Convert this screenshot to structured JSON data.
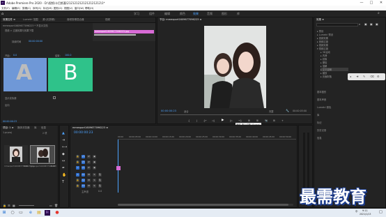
{
  "app": {
    "title": "Adobe Premiere Pro 2020 - D:\\视频\\卡巴斯基\\2121212121212121212\\1*",
    "logo": "Pr",
    "controls": [
      "—",
      "□",
      "✕"
    ]
  },
  "menu": [
    "文件(F)",
    "编辑(E)",
    "剪辑(C)",
    "序列(S)",
    "标记(M)",
    "图形(G)",
    "视图(V)",
    "窗口(W)",
    "帮助(H)"
  ],
  "workspaces": {
    "items": [
      "学习",
      "组件",
      "编辑",
      "颜色",
      "效果",
      "音频",
      "图形",
      "库"
    ],
    "active_index": 4,
    "search_icon": "search-icon"
  },
  "source_panel": {
    "tabs": [
      "效果控件 ≡",
      "Lumetri 范围",
      "源:(无剪辑)",
      "音频剪辑混合器",
      "视频"
    ],
    "clip_header": "mmexport1609677096223 * 不显示文档",
    "sub_label": "视频 > 过渡效果与效果下载",
    "timeline_clip": "mmexport1609677096223.jpg",
    "transition_time": "00:00:00:00",
    "transition_label": "持续时间",
    "a_label": "A",
    "b_label": "B",
    "start_label": "开始:",
    "start_val": "0.0",
    "end_label": "结束:",
    "end_val": "100.0",
    "show_actual": "显示实际源",
    "reverse": "反向",
    "bottom_time": "00:00:00:23"
  },
  "program_panel": {
    "title": "节目: mmexport1609677096223 ≡",
    "timecode": "00:00:00:23",
    "fit": "适合",
    "quality": "完整",
    "duration": "00:00:05:00",
    "tooltip": "播放-停止切换 (Space)",
    "transport": [
      "{",
      "|",
      "{←",
      "◁|",
      "▶",
      "|▷",
      "→}",
      "⊞",
      "⊞",
      "📷",
      "⊞",
      "+"
    ]
  },
  "effects_panel": {
    "title": "效果 ≡",
    "search_placeholder": "",
    "tree": [
      "预设",
      "Lumetri 预设",
      "音频效果",
      "音频过渡",
      "视频效果",
      "视频过渡",
      "3D运动",
      "内滑",
      "划像",
      "擦除",
      "溶解",
      "交叉溶解",
      "缩放",
      "页面剥落"
    ],
    "sections": [
      "基本图形",
      "基本声音",
      "Lumetri 颜色",
      "库",
      "标记",
      "历史记录",
      "信息"
    ]
  },
  "project_panel": {
    "title": "项目: 1 ≡",
    "tabs": [
      "媒体浏览器",
      "库",
      "信息"
    ],
    "path": "1.prproj",
    "item1_name": "mmexport1609677096223.jpg",
    "item1_dur": "5:00",
    "item2_name": "mmexport1609677096223",
    "item2_dur": "5:00",
    "count": "2 项"
  },
  "timeline": {
    "title": "mmexport1609677096223 ≡",
    "timecode": "00:00:00:23",
    "ruler": [
      "00:00",
      "00:00:05:00",
      "00:00:10:00",
      "00:00:15:00",
      "00:00:20:00",
      "00:00:25:00",
      "00:00:30:00",
      "00:00:35:00",
      "00:00:40:00",
      "00:00:45:00",
      "00:00:50:00"
    ],
    "video_tracks": [
      "V3",
      "V2",
      "V1"
    ],
    "audio_tracks": [
      "A1",
      "A2",
      "A3"
    ],
    "master": "主声道",
    "master_val": "0.0"
  },
  "watermark": "最需教育",
  "taskbar": {
    "time": "9:11",
    "date": "2021/1/13",
    "lang": "中",
    "notify": "□"
  }
}
